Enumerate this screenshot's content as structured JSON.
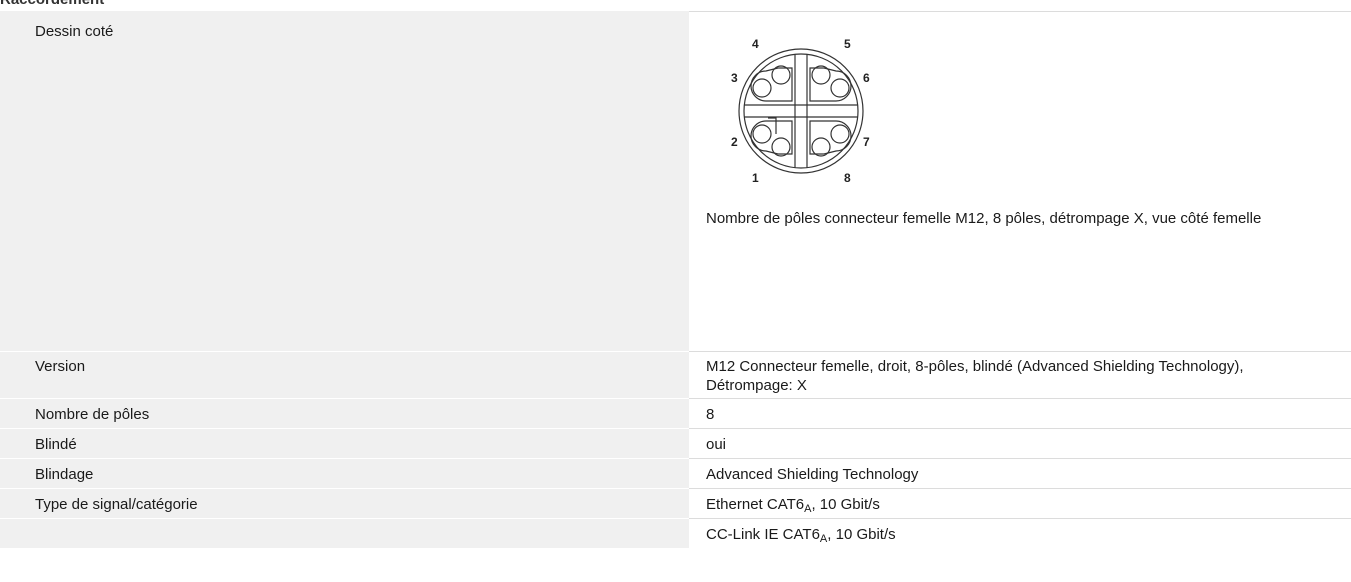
{
  "section_heading": "Raccordement",
  "rows": [
    {
      "label": "Dessin coté",
      "drawing": {
        "icon": "m12-x-coded-female-pin-diagram",
        "pin_numbers": [
          "1",
          "2",
          "3",
          "4",
          "5",
          "6",
          "7",
          "8"
        ]
      },
      "caption": "Nombre de pôles connecteur femelle M12, 8 pôles, détrompage X, vue côté femelle"
    },
    {
      "label": "Version",
      "value": "M12 Connecteur femelle, droit, 8-pôles, blindé (Advanced Shielding Technology), Détrompage: X"
    },
    {
      "label": "Nombre de pôles",
      "value": "8"
    },
    {
      "label": "Blindé",
      "value": "oui"
    },
    {
      "label": "Blindage",
      "value": "Advanced Shielding Technology"
    },
    {
      "label": "Type de signal/catégorie",
      "values": [
        {
          "base": "Ethernet CAT6",
          "sub": "A",
          "rest": ", 10 Gbit/s"
        },
        {
          "base": "CC-Link IE CAT6",
          "sub": "A",
          "rest": ", 10 Gbit/s"
        }
      ]
    }
  ]
}
